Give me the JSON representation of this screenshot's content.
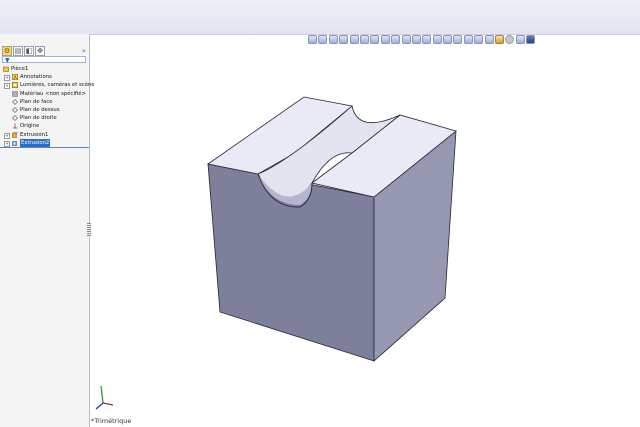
{
  "feature_tree": {
    "tabs": [
      "feature-manager-tab",
      "property-manager-tab",
      "configuration-manager-tab",
      "dimxpert-tab"
    ],
    "filter_icon": "funnel-icon",
    "root": "Pièce1",
    "items": [
      {
        "label": "Annotations",
        "icon": "annotations-icon",
        "expandable": true
      },
      {
        "label": "Lumières, caméras et scène",
        "icon": "lights-cameras-icon",
        "expandable": true
      },
      {
        "label": "Matériau <non spécifié>",
        "icon": "material-icon",
        "expandable": false
      },
      {
        "label": "Plan de face",
        "icon": "plane-icon",
        "expandable": false
      },
      {
        "label": "Plan de dessus",
        "icon": "plane-icon",
        "expandable": false
      },
      {
        "label": "Plan de droite",
        "icon": "plane-icon",
        "expandable": false
      },
      {
        "label": "Origine",
        "icon": "origin-icon",
        "expandable": false
      },
      {
        "label": "Extrusion1",
        "icon": "extrude-icon",
        "expandable": true
      },
      {
        "label": "Extrusion2",
        "icon": "cut-extrude-icon",
        "expandable": true,
        "selected": true
      }
    ]
  },
  "viewport": {
    "view_name": "*Trimétrique",
    "model_colors": {
      "top": "#e9eaf6",
      "left": "#7d7f9b",
      "right": "#9698b2",
      "groove": "#e2e4f0",
      "groove_shadow": "#b3b6cc",
      "edge": "#23253a"
    }
  },
  "colors": {
    "accent": "#2f6cc4",
    "topbar": "#e6e8f3"
  }
}
